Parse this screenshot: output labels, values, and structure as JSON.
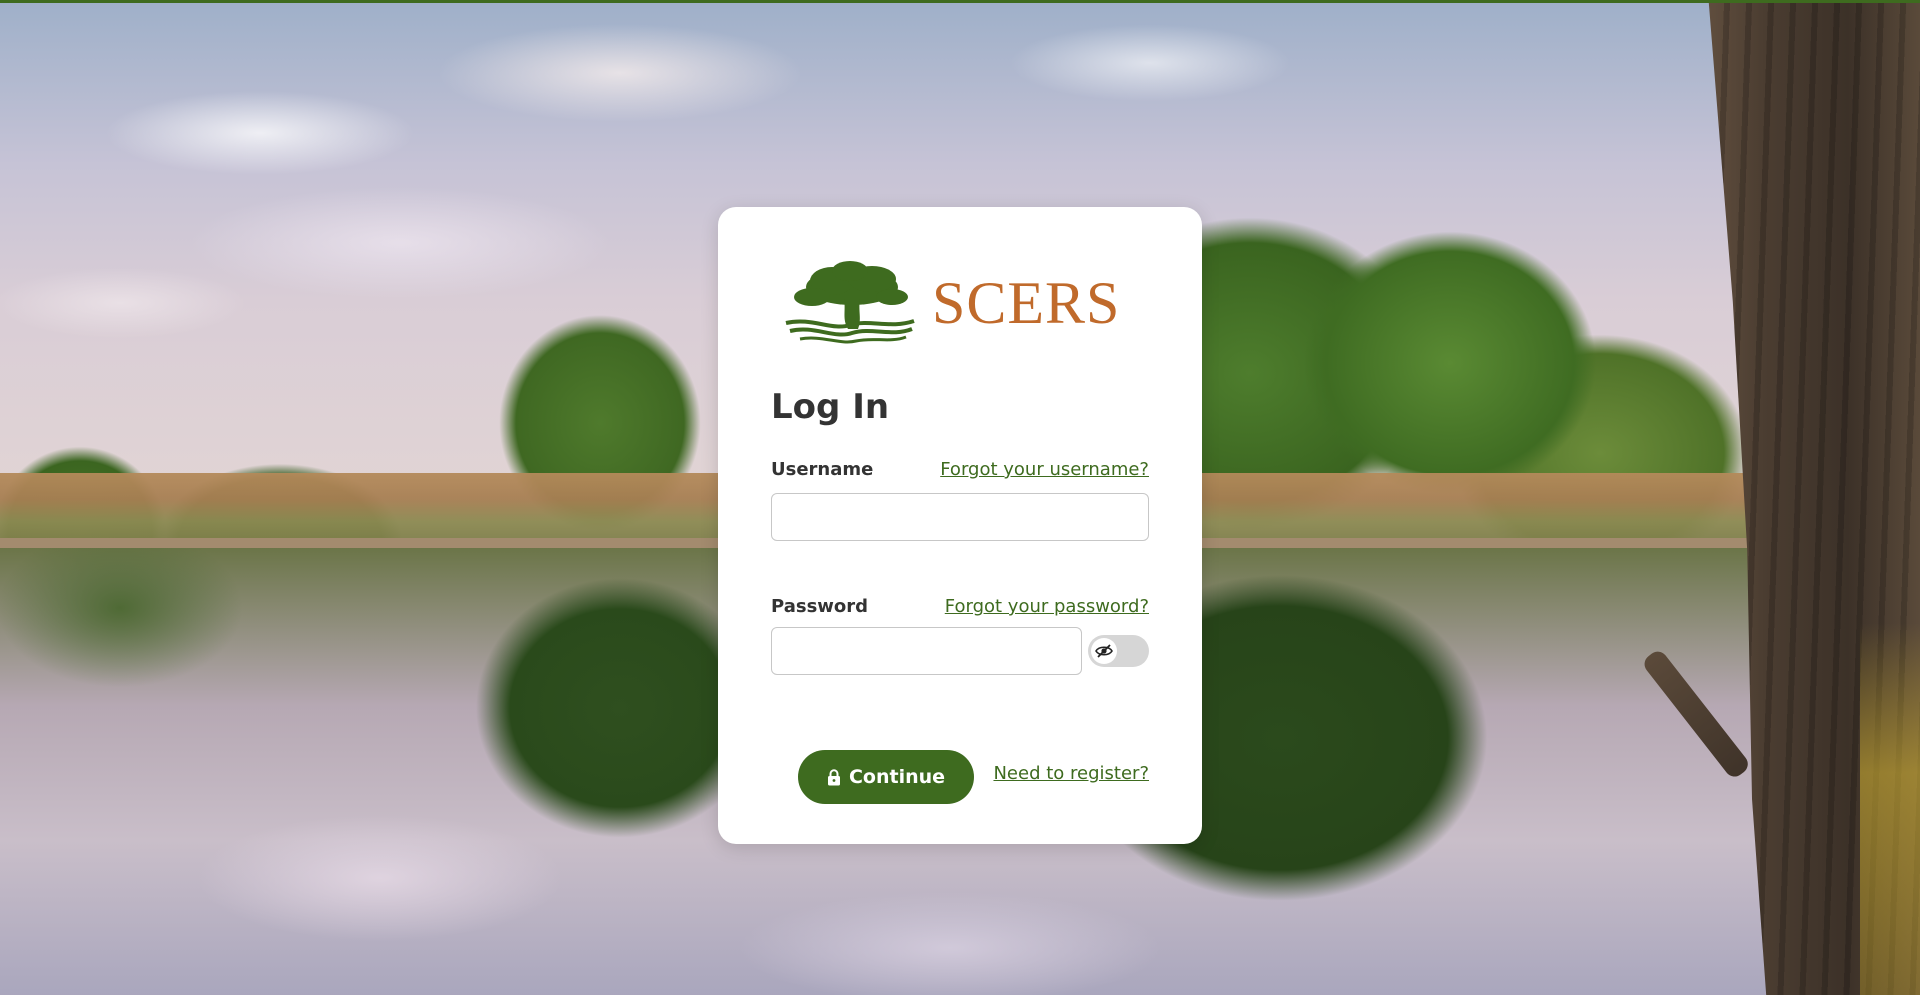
{
  "brand": {
    "name": "SCERS",
    "accent": "#3e6b1f",
    "logo_text_color": "#c06a2b"
  },
  "login": {
    "title": "Log In",
    "username": {
      "label": "Username",
      "forgot_link": "Forgot your username?",
      "value": "",
      "placeholder": ""
    },
    "password": {
      "label": "Password",
      "forgot_link": "Forgot your password?",
      "value": "",
      "placeholder": "",
      "visibility_toggle_icon": "eye-slash-icon",
      "visibility_on": false
    },
    "continue_button": {
      "label": "Continue",
      "icon": "lock-icon"
    },
    "register_link": "Need to register?"
  }
}
